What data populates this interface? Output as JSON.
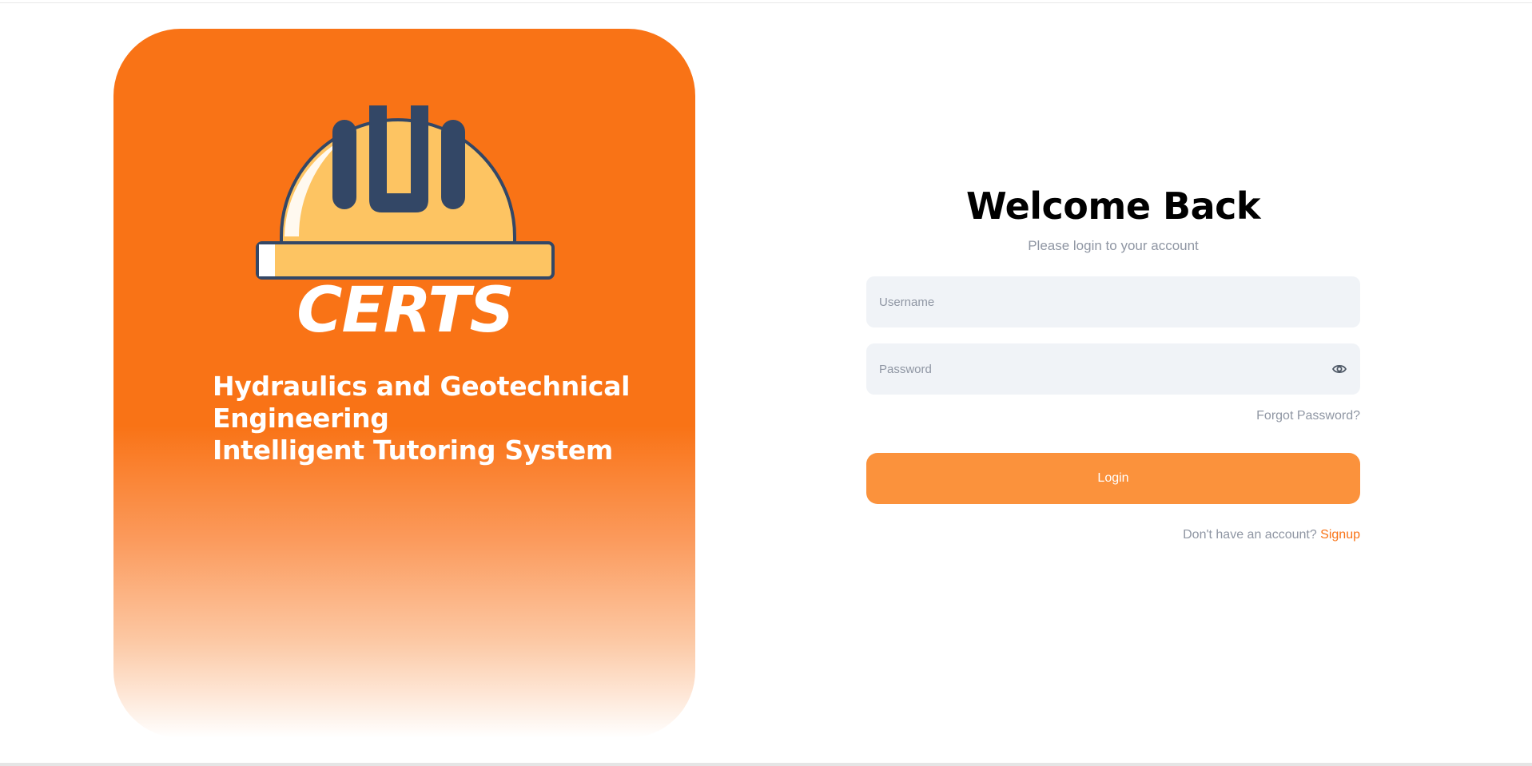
{
  "brand": {
    "logo_text": "CERTS",
    "title_lines": [
      "Hydraulics and Geotechnical",
      "Engineering",
      "Intelligent Tutoring System"
    ],
    "panel_color": "#f97316",
    "helmet_color": "#fdc462",
    "stripe_color": "#334766"
  },
  "login": {
    "heading": "Welcome Back",
    "subtitle": "Please login to your account",
    "username_placeholder": "Username",
    "password_placeholder": "Password",
    "password_toggle_icon": "eye-icon",
    "forgot_label": "Forgot Password?",
    "submit_label": "Login",
    "signup_prompt": "Don't have an account?",
    "signup_label": "Signup",
    "accent_color": "#fb923c"
  }
}
